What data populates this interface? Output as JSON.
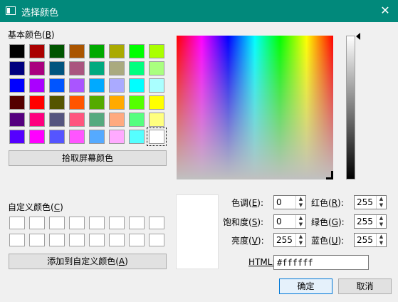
{
  "window": {
    "title": "选择颜色",
    "close_glyph": "✕"
  },
  "basic_colors": {
    "label_prefix": "基本颜色(",
    "label_key": "B",
    "label_suffix": ")",
    "rows": [
      [
        "#000000",
        "#aa0000",
        "#005500",
        "#aa5500",
        "#00aa00",
        "#aaaa00",
        "#00ff00",
        "#aaff00"
      ],
      [
        "#00007f",
        "#aa007f",
        "#00557f",
        "#aa557f",
        "#00aa7f",
        "#aaaa7f",
        "#00ff7f",
        "#aaff7f"
      ],
      [
        "#0000ff",
        "#aa00ff",
        "#0055ff",
        "#aa55ff",
        "#00aaff",
        "#aaaaff",
        "#00ffff",
        "#aaffff"
      ],
      [
        "#550000",
        "#ff0000",
        "#555500",
        "#ff5500",
        "#55aa00",
        "#ffaa00",
        "#55ff00",
        "#ffff00"
      ],
      [
        "#55007f",
        "#ff007f",
        "#55557f",
        "#ff557f",
        "#55aa7f",
        "#ffaa7f",
        "#55ff7f",
        "#ffff7f"
      ],
      [
        "#5500ff",
        "#ff00ff",
        "#5555ff",
        "#ff55ff",
        "#55aaff",
        "#ffaaff",
        "#55ffff",
        "#ffffff"
      ]
    ],
    "selected": "#ffffff"
  },
  "pick_screen_button": "拾取屏幕颜色",
  "custom_colors": {
    "label_prefix": "自定义颜色(",
    "label_key": "C",
    "label_suffix": ")",
    "count": 16
  },
  "add_custom_button": {
    "prefix": "添加到自定义颜色(",
    "key": "A",
    "suffix": ")"
  },
  "fields": {
    "hue": {
      "prefix": "色调(",
      "key": "E",
      "suffix": "):",
      "value": "0"
    },
    "saturation": {
      "prefix": "饱和度(",
      "key": "S",
      "suffix": "):",
      "value": "0"
    },
    "value": {
      "prefix": "亮度(",
      "key": "V",
      "suffix": "):",
      "value": "255"
    },
    "red": {
      "prefix": "红色(",
      "key": "R",
      "suffix": "):",
      "value": "255"
    },
    "green": {
      "prefix": "绿色(",
      "key": "G",
      "suffix": "):",
      "value": "255"
    },
    "blue": {
      "prefix": "蓝色(",
      "key": "U",
      "suffix": "):",
      "value": "255"
    }
  },
  "html_field": {
    "label": "HTML:",
    "value": "#ffffff"
  },
  "current_color": "#ffffff",
  "ok_button": "确定",
  "cancel_button": "取消",
  "accent_color": "#01897b"
}
